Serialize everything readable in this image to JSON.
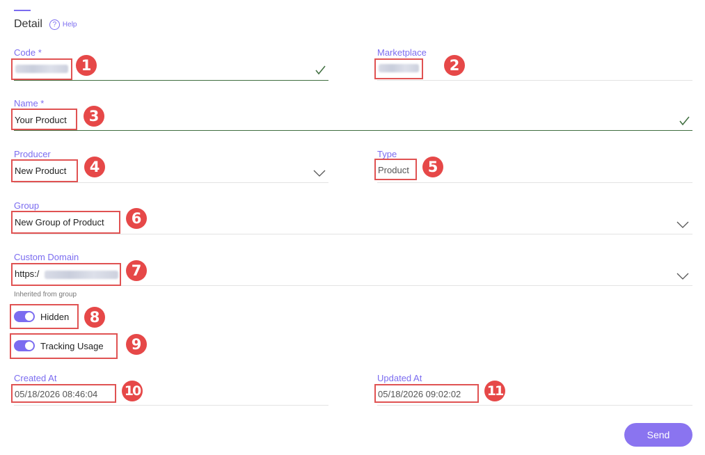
{
  "header": {
    "title": "Detail",
    "help_icon": "?",
    "help_label": "Help"
  },
  "form": {
    "code": {
      "label": "Code *",
      "value": ""
    },
    "marketplace": {
      "label": "Marketplace",
      "value": ""
    },
    "name": {
      "label": "Name *",
      "value": "Your Product"
    },
    "producer": {
      "label": "Producer",
      "value": "New Product"
    },
    "type": {
      "label": "Type",
      "value": "Product"
    },
    "group": {
      "label": "Group",
      "value": "New Group of Product"
    },
    "custom_domain": {
      "label": "Custom Domain",
      "value": "https:/",
      "hint": "Inherited from group"
    },
    "hidden": {
      "label": "Hidden",
      "on": true
    },
    "tracking": {
      "label": "Tracking Usage",
      "on": true
    },
    "created_at": {
      "label": "Created At",
      "value": "05/18/2026 08:46:04"
    },
    "updated_at": {
      "label": "Updated At",
      "value": "05/18/2026 09:02:02"
    }
  },
  "badges": [
    "1",
    "2",
    "3",
    "4",
    "5",
    "6",
    "7",
    "8",
    "9",
    "10",
    "11"
  ],
  "actions": {
    "send_label": "Send"
  },
  "colors": {
    "accent": "#7b6cf0",
    "annotation": "#e64848",
    "valid": "#3f6e3f"
  },
  "icons": {
    "valid": "check-icon",
    "dropdown": "chevron-down-icon",
    "help": "help-circle-icon"
  }
}
